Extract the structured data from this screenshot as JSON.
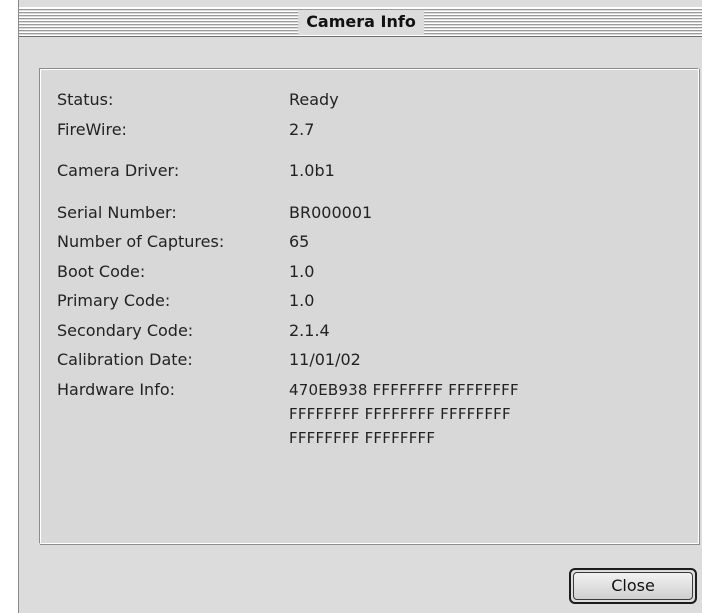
{
  "window": {
    "title": "Camera Info"
  },
  "info": [
    {
      "label": "Status:",
      "value": "Ready"
    },
    {
      "label": "FireWire:",
      "value": "2.7"
    },
    {
      "label": "Camera Driver:",
      "value": "1.0b1"
    },
    {
      "label": "Serial Number:",
      "value": "BR000001"
    },
    {
      "label": "Number of Captures:",
      "value": "65"
    },
    {
      "label": "Boot Code:",
      "value": "1.0"
    },
    {
      "label": "Primary Code:",
      "value": "1.0"
    },
    {
      "label": "Secondary Code:",
      "value": "2.1.4"
    },
    {
      "label": "Calibration Date:",
      "value": "11/01/02"
    }
  ],
  "hardware": {
    "label": "Hardware Info:",
    "lines": [
      "470EB938 FFFFFFFF FFFFFFFF",
      "FFFFFFFF FFFFFFFF FFFFFFFF",
      "FFFFFFFF FFFFFFFF"
    ]
  },
  "buttons": {
    "close": "Close"
  }
}
